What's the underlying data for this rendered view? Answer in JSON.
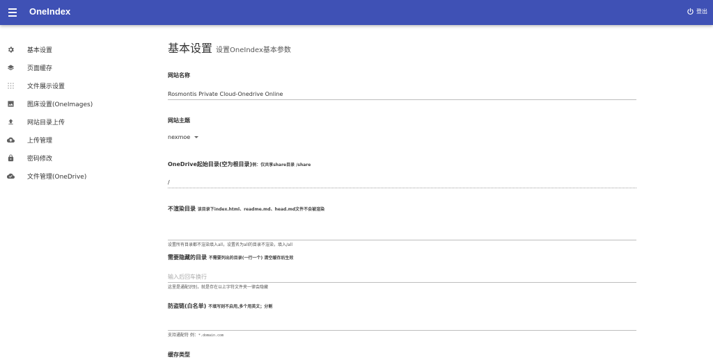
{
  "header": {
    "brand": "OneIndex",
    "logout_label": "登出",
    "color": "#3f51b5"
  },
  "sidebar": {
    "items": [
      {
        "label": "基本设置",
        "icon": "gear-icon"
      },
      {
        "label": "页面缓存",
        "icon": "layers-icon"
      },
      {
        "label": "文件展示设置",
        "icon": "grid-dots-icon"
      },
      {
        "label": "图床设置(OneImages)",
        "icon": "image-icon"
      },
      {
        "label": "网站目录上传",
        "icon": "upload-icon"
      },
      {
        "label": "上传管理",
        "icon": "cloud-upload-icon"
      },
      {
        "label": "密码修改",
        "icon": "lock-icon"
      },
      {
        "label": "文件管理(OneDrive)",
        "icon": "cloud-done-icon"
      }
    ]
  },
  "main": {
    "title": "基本设置",
    "subtitle": "设置OneIndex基本参数",
    "site_name": {
      "label": "网站名称",
      "value": "Rosmontis Private Cloud-Onedrive Online"
    },
    "theme": {
      "label": "网站主题",
      "value": "nexmoe"
    },
    "root_dir": {
      "label": "OneDrive起始目录(空为根目录)",
      "note": "例：仅共享share目录 /share",
      "value": "/"
    },
    "no_render": {
      "label": "不渲染目录",
      "note": "该目录下index.html、readme.md、head.md文件不会被渲染",
      "value": "",
      "hint": "设置所有目录都不渲染填入all，设置名为all的目录不渲染，填入/all"
    },
    "hidden_dirs": {
      "label": "需要隐藏的目录",
      "note": "不需要列出的目录(一行一个) 清空缓存后生效",
      "placeholder": "输入后回车换行",
      "hint": "这里是通配识别，就是存在以上字符文件夹一律会隐藏"
    },
    "hotlink": {
      "label": "防盗链(白名单)",
      "note": "不填写则不启用,多个用英文；分割",
      "value": "",
      "hint_prefix": "支持通配符 例：",
      "hint_code": "*.domain.com"
    },
    "cache_type": {
      "label": "缓存类型"
    }
  }
}
